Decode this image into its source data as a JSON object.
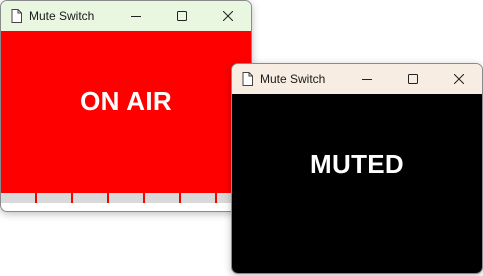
{
  "windows": [
    {
      "title": "Mute Switch",
      "status_label": "ON AIR",
      "background": "#ff0000",
      "titlebar_color": "#e9f6e0",
      "icon": "document-icon"
    },
    {
      "title": "Mute Switch",
      "status_label": "MUTED",
      "background": "#000000",
      "titlebar_color": "#f7ede3",
      "icon": "document-icon"
    }
  ],
  "window_controls": {
    "minimize_icon": "minimize-icon",
    "maximize_icon": "maximize-icon",
    "close_icon": "close-icon"
  }
}
